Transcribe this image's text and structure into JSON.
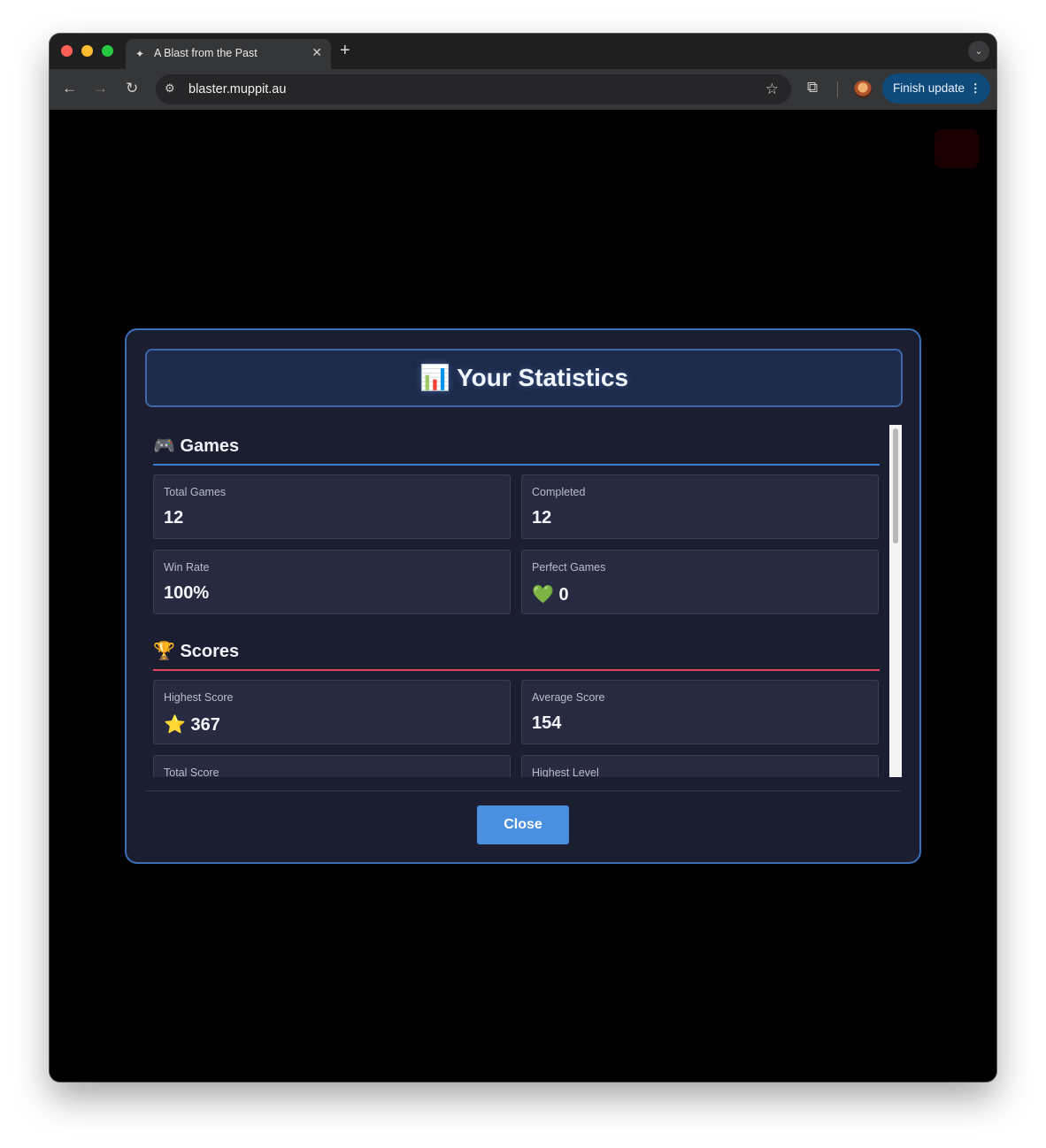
{
  "browser": {
    "tab_title": "A Blast from the Past",
    "tab_close": "✕",
    "new_tab": "+",
    "url": "blaster.muppit.au",
    "update_label": "Finish update",
    "icons": {
      "back": "←",
      "forward": "→",
      "reload": "↻",
      "site_info": "⚙",
      "star": "☆",
      "extensions": "⧉",
      "menu": "⋮",
      "tab_search": "⌄",
      "favicon": "✦"
    }
  },
  "modal": {
    "title": "📊 Your Statistics",
    "close_label": "Close",
    "sections": [
      {
        "title": "🎮 Games",
        "accent": "#3f7ad1",
        "cards": [
          {
            "label": "Total Games",
            "value": "12"
          },
          {
            "label": "Completed",
            "value": "12"
          },
          {
            "label": "Win Rate",
            "value": "100%"
          },
          {
            "label": "Perfect Games",
            "value": "💚 0"
          }
        ]
      },
      {
        "title": "🏆 Scores",
        "accent": "#e0455f",
        "cards": [
          {
            "label": "Highest Score",
            "value": "⭐ 367"
          },
          {
            "label": "Average Score",
            "value": "154"
          },
          {
            "label": "Total Score",
            "value": ""
          },
          {
            "label": "Highest Level",
            "value": ""
          }
        ]
      }
    ]
  }
}
